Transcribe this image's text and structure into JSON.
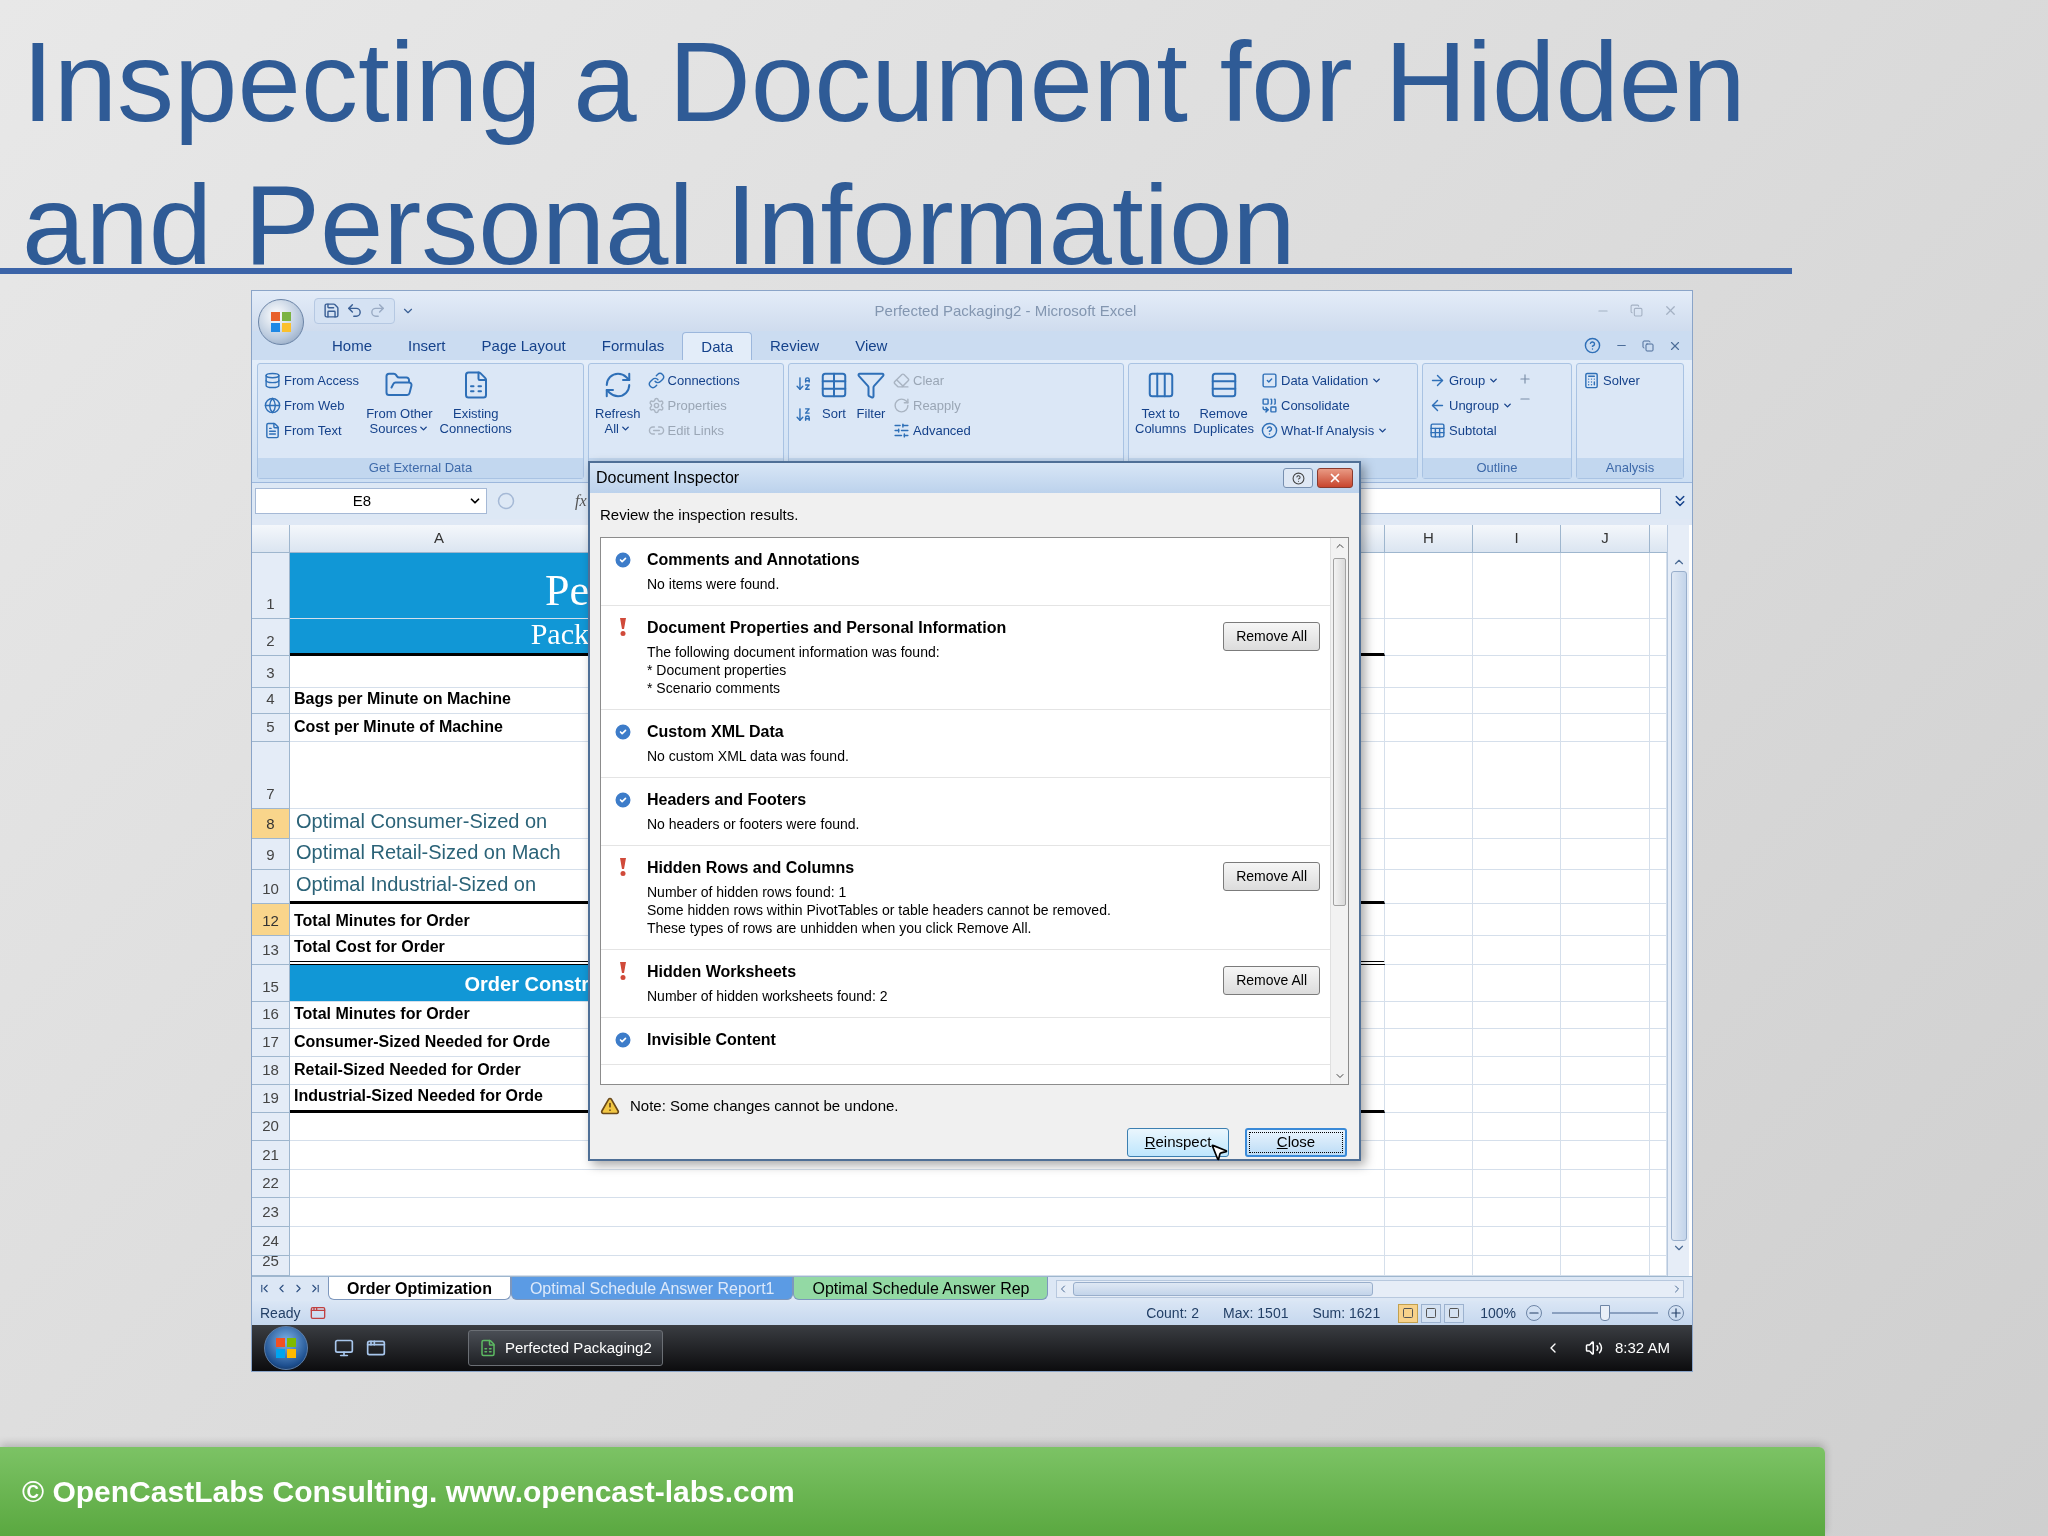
{
  "slide": {
    "title": "Inspecting a Document for Hidden and Personal Information",
    "footer": "© OpenCastLabs Consulting. www.opencast-labs.com"
  },
  "excel": {
    "window_title": "Perfected Packaging2 - Microsoft Excel",
    "tabs": [
      {
        "label": "Home",
        "selected": false
      },
      {
        "label": "Insert",
        "selected": false
      },
      {
        "label": "Page Layout",
        "selected": false
      },
      {
        "label": "Formulas",
        "selected": false
      },
      {
        "label": "Data",
        "selected": true
      },
      {
        "label": "Review",
        "selected": false
      },
      {
        "label": "View",
        "selected": false
      }
    ],
    "ribbon": {
      "groups": [
        {
          "label": "Get External Data",
          "items": [
            {
              "kind": "small",
              "label": "From Access",
              "disabled": false,
              "dropdown": false
            },
            {
              "kind": "small",
              "label": "From Web",
              "disabled": false,
              "dropdown": false
            },
            {
              "kind": "small",
              "label": "From Text",
              "disabled": false,
              "dropdown": false
            },
            {
              "kind": "large",
              "lines": [
                "From Other",
                "Sources"
              ],
              "disabled": false,
              "dropdown": true
            },
            {
              "kind": "large",
              "lines": [
                "Existing",
                "Connections"
              ],
              "disabled": false,
              "dropdown": false
            }
          ]
        },
        {
          "items": [
            {
              "kind": "large",
              "lines": [
                "Refresh",
                "All"
              ],
              "disabled": false,
              "dropdown": true
            },
            {
              "kind": "small",
              "label": "Connections",
              "disabled": false,
              "dropdown": false
            },
            {
              "kind": "small",
              "label": "Properties",
              "disabled": true,
              "dropdown": false
            },
            {
              "kind": "small",
              "label": "Edit Links",
              "disabled": true,
              "dropdown": false
            }
          ]
        },
        {
          "items": [
            {
              "kind": "icon",
              "disabled": false,
              "dropdown": false
            },
            {
              "kind": "icon",
              "disabled": false,
              "dropdown": false
            },
            {
              "kind": "large",
              "lines": [
                "Sort"
              ],
              "disabled": false,
              "dropdown": false
            },
            {
              "kind": "large",
              "lines": [
                "Filter"
              ],
              "disabled": false,
              "dropdown": false
            },
            {
              "kind": "small",
              "label": "Clear",
              "disabled": true,
              "dropdown": false
            },
            {
              "kind": "small",
              "label": "Reapply",
              "disabled": true,
              "dropdown": false
            },
            {
              "kind": "small",
              "label": "Advanced",
              "disabled": false,
              "dropdown": false
            }
          ]
        },
        {
          "items": [
            {
              "kind": "large",
              "lines": [
                "Text to",
                "Columns"
              ],
              "disabled": false,
              "dropdown": false
            },
            {
              "kind": "large",
              "lines": [
                "Remove",
                "Duplicates"
              ],
              "disabled": false,
              "dropdown": false
            },
            {
              "kind": "small",
              "label": "Data Validation",
              "disabled": false,
              "dropdown": true
            },
            {
              "kind": "small",
              "label": "Consolidate",
              "disabled": false,
              "dropdown": false
            },
            {
              "kind": "small",
              "label": "What-If Analysis",
              "disabled": false,
              "dropdown": true
            }
          ]
        },
        {
          "label": "Outline",
          "items": [
            {
              "kind": "small",
              "label": "Group",
              "disabled": false,
              "dropdown": true
            },
            {
              "kind": "small",
              "label": "Ungroup",
              "disabled": false,
              "dropdown": true
            },
            {
              "kind": "small",
              "label": "Subtotal",
              "disabled": false,
              "dropdown": false
            }
          ]
        },
        {
          "label": "Analysis",
          "items": [
            {
              "kind": "small",
              "label": "Solver",
              "disabled": false,
              "dropdown": false
            }
          ]
        }
      ]
    },
    "name_box": "E8",
    "fx_label": "fx",
    "columns": {
      "left": [
        "A"
      ],
      "right": [
        "H",
        "I",
        "J"
      ]
    },
    "rows": [
      {
        "number": "1",
        "kind": "banner-title",
        "text": "Pe",
        "selected": false
      },
      {
        "number": "2",
        "kind": "banner-subtitle",
        "text": "Pack",
        "selected": false
      },
      {
        "number": "3",
        "kind": "blank",
        "selected": false
      },
      {
        "number": "4",
        "kind": "label",
        "text": "Bags per Minute on Machine",
        "selected": false
      },
      {
        "number": "5",
        "kind": "label",
        "text": "Cost per Minute of Machine",
        "selected": false
      },
      {
        "number": "7",
        "kind": "blank",
        "selected": false
      },
      {
        "number": "8",
        "kind": "accent",
        "text": "Optimal Consumer-Sized on",
        "selected": true
      },
      {
        "number": "9",
        "kind": "accent",
        "text": "Optimal Retail-Sized on Mach",
        "selected": false
      },
      {
        "number": "10",
        "kind": "accent",
        "text": "Optimal Industrial-Sized on",
        "selected": false
      },
      {
        "number": "12",
        "kind": "label",
        "text": "Total Minutes for Order",
        "selected": true
      },
      {
        "number": "13",
        "kind": "label",
        "text": "Total Cost for Order",
        "selected": false
      },
      {
        "number": "15",
        "kind": "section",
        "text": "Order Constr",
        "selected": false
      },
      {
        "number": "16",
        "kind": "label",
        "text": "Total Minutes for Order",
        "selected": false
      },
      {
        "number": "17",
        "kind": "label",
        "text": "Consumer-Sized Needed for Orde",
        "selected": false
      },
      {
        "number": "18",
        "kind": "label",
        "text": "Retail-Sized Needed for Order",
        "selected": false
      },
      {
        "number": "19",
        "kind": "label",
        "text": "Industrial-Sized Needed for Orde",
        "selected": false
      },
      {
        "number": "20",
        "kind": "blank",
        "selected": false
      },
      {
        "number": "21",
        "kind": "blank",
        "selected": false
      },
      {
        "number": "22",
        "kind": "blank",
        "selected": false
      },
      {
        "number": "23",
        "kind": "blank",
        "selected": false
      },
      {
        "number": "24",
        "kind": "blank",
        "selected": false
      },
      {
        "number": "25",
        "kind": "blank",
        "selected": false
      }
    ],
    "sheet_tabs": [
      {
        "label": "Order Optimization",
        "selected": true
      },
      {
        "label": "Optimal Schedule Answer Report1",
        "selected": false,
        "color": "#5b9be4"
      },
      {
        "label": "Optimal Schedule Answer Rep",
        "selected": false,
        "color": "#93d9a4"
      }
    ],
    "status_bar": {
      "ready": "Ready",
      "count": "Count: 2",
      "max": "Max: 1501",
      "sum": "Sum: 1621",
      "views": [
        {
          "selected": true
        },
        {
          "selected": false
        },
        {
          "selected": false
        }
      ],
      "zoom": "100%",
      "zoom_slider": {
        "level": 0.5
      }
    },
    "taskbar": {
      "task": "Perfected Packaging2",
      "clock": "8:32 AM"
    }
  },
  "dialog": {
    "title": "Document Inspector",
    "intro": "Review the inspection results.",
    "items": [
      {
        "found": false,
        "title": "Comments and Annotations",
        "lines": [
          "No items were found."
        ]
      },
      {
        "found": true,
        "title": "Document Properties and Personal Information",
        "lines": [
          "The following document information was found:",
          "* Document properties",
          "* Scenario comments"
        ],
        "action": "Remove All"
      },
      {
        "found": false,
        "title": "Custom XML Data",
        "lines": [
          "No custom XML data was found."
        ]
      },
      {
        "found": false,
        "title": "Headers and Footers",
        "lines": [
          "No headers or footers were found."
        ]
      },
      {
        "found": true,
        "title": "Hidden Rows and Columns",
        "lines": [
          "Number of hidden rows found: 1",
          "Some hidden rows within PivotTables or table headers cannot be removed.",
          "These types of rows are unhidden when you click Remove All."
        ],
        "action": "Remove All"
      },
      {
        "found": true,
        "title": "Hidden Worksheets",
        "lines": [
          "Number of hidden worksheets found: 2"
        ],
        "action": "Remove All"
      },
      {
        "found": false,
        "title": "Invisible Content"
      }
    ],
    "note": "Note: Some changes cannot be undone.",
    "buttons": [
      {
        "label": "Reinspect",
        "focused": false
      },
      {
        "label": "Close",
        "focused": true
      }
    ]
  }
}
